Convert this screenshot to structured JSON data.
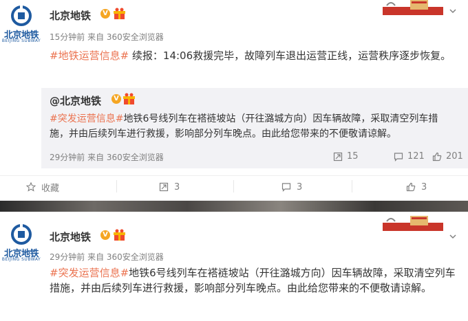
{
  "colors": {
    "tag": "#eb7350",
    "name": "#333333",
    "meta": "#808080",
    "repost_bg": "#f2f2f5",
    "brand_blue": "#1e5aa0"
  },
  "post1": {
    "avatar_text": "北京地铁",
    "avatar_sub": "BEIJING SUBWAY",
    "name": "北京地铁",
    "verified": "V",
    "meta": "15分钟前 来自 360安全浏览器",
    "tag": "#地铁运营信息#",
    "text": " 续报：14:06救援完毕，故障列车退出运营正线，运营秩序逐步恢复。",
    "repost": {
      "name": "@北京地铁",
      "verified": "V",
      "tag": "#突发运营信息#",
      "text": "地铁6号线列车在褡裢坡站（开往潞城方向）因车辆故障，采取清空列车措施，并由后续列车进行救援，影响部分列车晚点。由此给您带来的不便敬请谅解。",
      "meta": "29分钟前 来自 360安全浏览器",
      "reposts": "15",
      "comments": "121",
      "likes": "201"
    },
    "actions": {
      "favorite": "收藏",
      "repost": "3",
      "comment": "3",
      "like": "3"
    }
  },
  "post2": {
    "avatar_text": "北京地铁",
    "avatar_sub": "BEIJING SUBWAY",
    "name": "北京地铁",
    "verified": "V",
    "meta": "29分钟前 来自 360安全浏览器",
    "tag": "#突发运营信息#",
    "text": "地铁6号线列车在褡裢坡站（开往潞城方向）因车辆故障，采取清空列车措施，并由后续列车进行救援，影响部分列车晚点。由此给您带来的不便敬请谅解。"
  },
  "icons": {
    "chevron": "chevron-down-icon",
    "repost": "repost-icon",
    "comment": "comment-icon",
    "like": "thumbs-up-icon",
    "favorite": "star-icon"
  }
}
